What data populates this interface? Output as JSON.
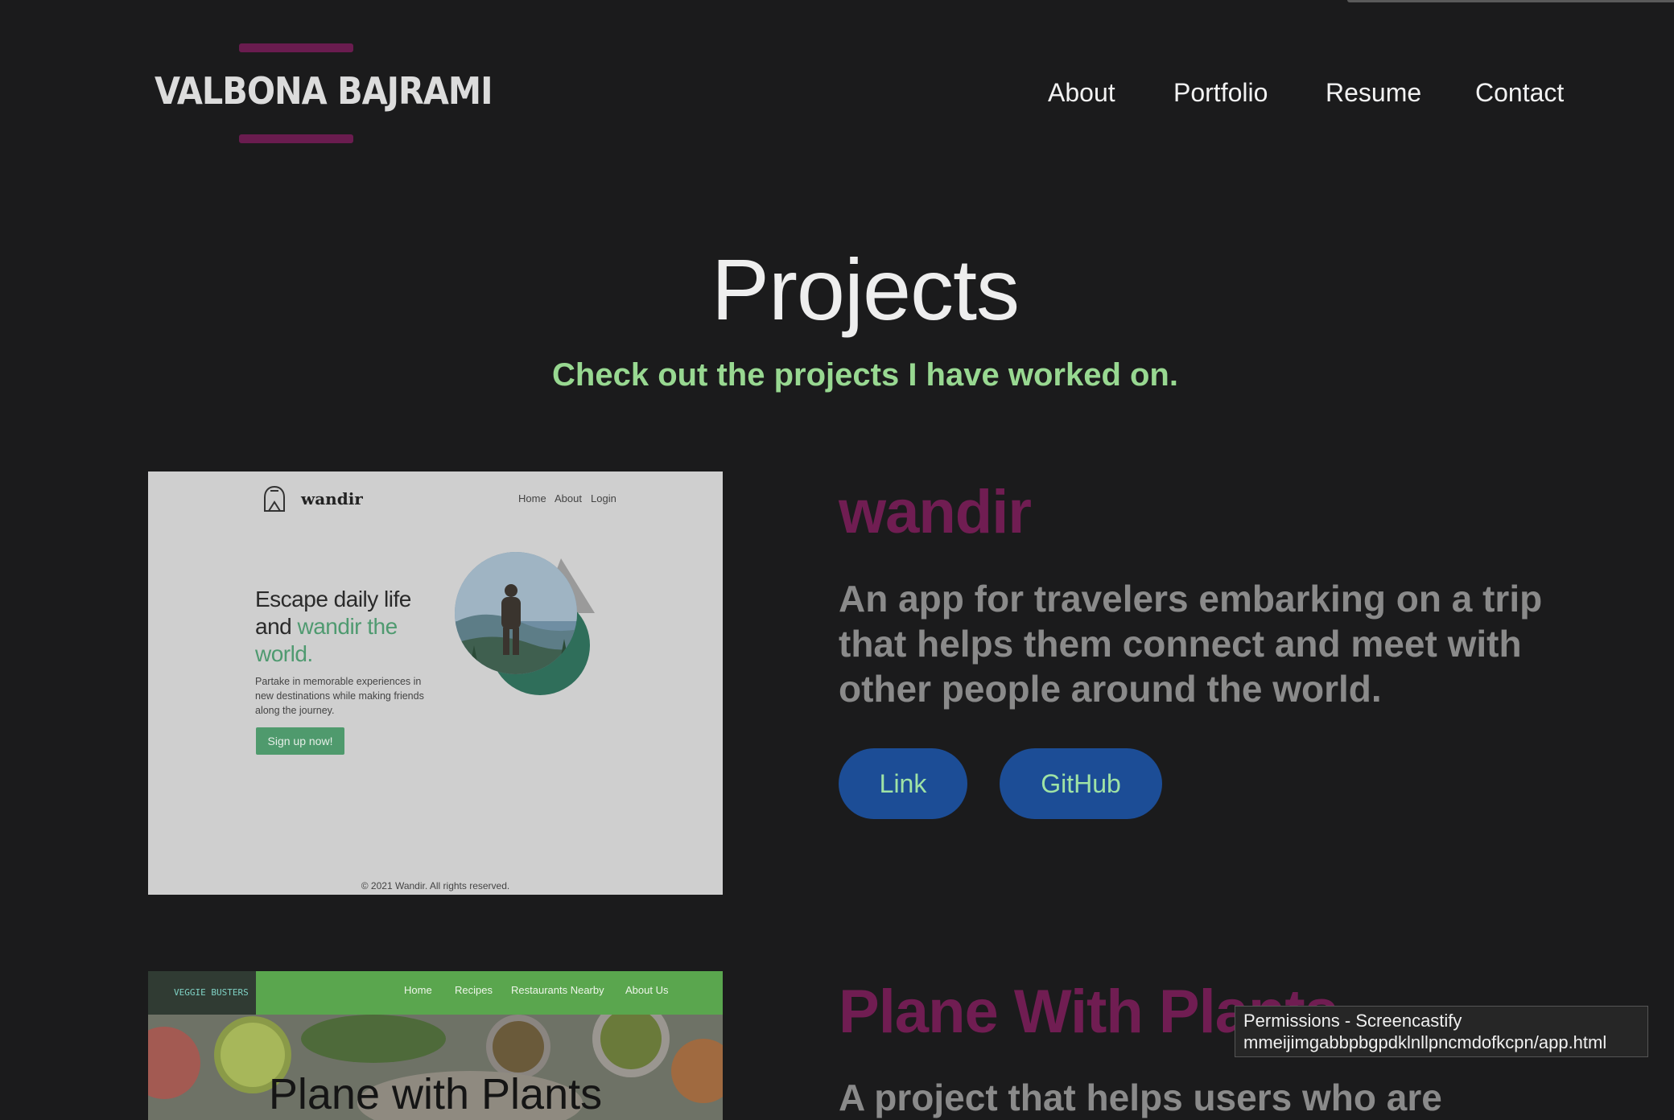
{
  "header": {
    "logo_text": "VALBONA BAJRAMI",
    "nav": [
      "About",
      "Portfolio",
      "Resume",
      "Contact"
    ]
  },
  "section": {
    "title": "Projects",
    "subtitle": "Check out the projects I have worked on."
  },
  "projects": [
    {
      "title": "wandir",
      "description": "An app for travelers embarking on a trip that helps them connect and meet with other people around the world.",
      "link_label": "Link",
      "github_label": "GitHub",
      "preview": {
        "brand": "wandir",
        "nav": [
          "Home",
          "About",
          "Login"
        ],
        "headline_plain": "Escape daily life and ",
        "headline_accent": "wandir the world.",
        "body": "Partake in memorable experiences in new destinations while making friends along the journey.",
        "cta": "Sign up now!",
        "footer": "© 2021 Wandir. All rights reserved."
      }
    },
    {
      "title": "Plane With Plants",
      "description": "A project that helps users who are",
      "preview": {
        "logo": "VEGGIE BUSTERS",
        "nav": [
          "Home",
          "Recipes",
          "Restaurants Nearby",
          "About Us"
        ],
        "title": "Plane with Plants"
      }
    }
  ],
  "tooltip": {
    "line1": "Permissions - Screencastify",
    "line2": "mmeijimgabbpbgpdklnllpncmdofkcpn/app.html"
  },
  "colors": {
    "background": "#1b1b1c",
    "accent_purple": "#701d52",
    "accent_green": "#98d891",
    "button_blue": "#1c4d96"
  }
}
